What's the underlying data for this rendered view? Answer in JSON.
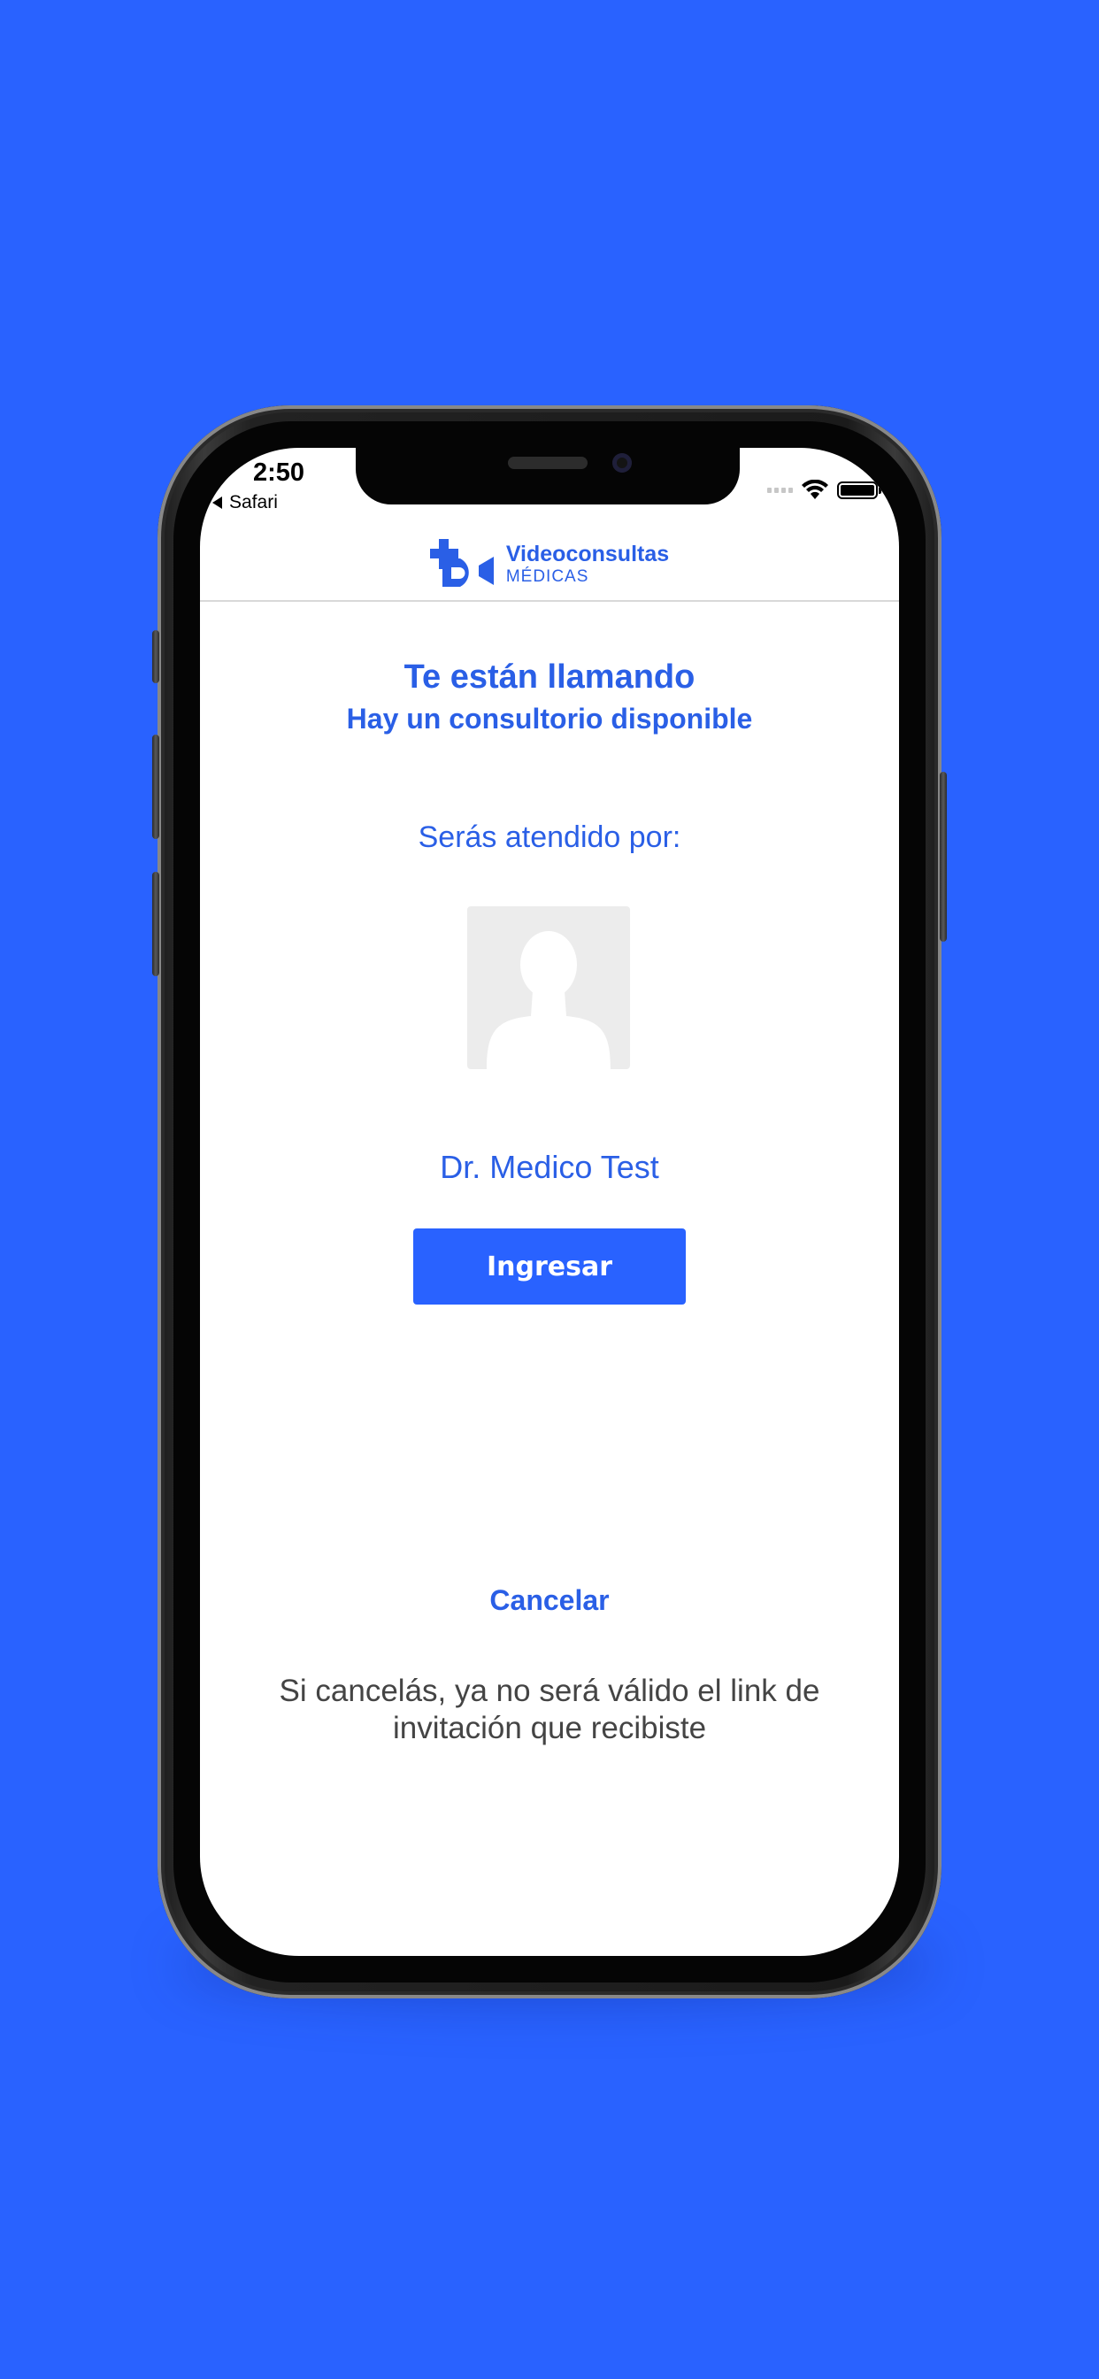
{
  "colors": {
    "background": "#2962ff",
    "accent": "#2a5fe6",
    "button": "#2962ff",
    "text_muted": "#444444",
    "avatar_bg": "#ececec"
  },
  "status_bar": {
    "time": "2:50",
    "back_app": "Safari",
    "icons": [
      "cellular-signal-icon",
      "wifi-icon",
      "battery-icon"
    ]
  },
  "header": {
    "logo_title": "Videoconsultas",
    "logo_subtitle": "MÉDICAS",
    "logo_icon": "medical-video-logo-icon"
  },
  "main": {
    "title": "Te están llamando",
    "subtitle": "Hay un consultorio disponible",
    "attended_label": "Serás atendido por:",
    "avatar_icon": "user-placeholder-icon",
    "doctor_name": "Dr. Medico Test",
    "enter_button": "Ingresar",
    "cancel_link": "Cancelar",
    "cancel_notice": "Si cancelás, ya no será válido el link de invitación que recibiste"
  }
}
